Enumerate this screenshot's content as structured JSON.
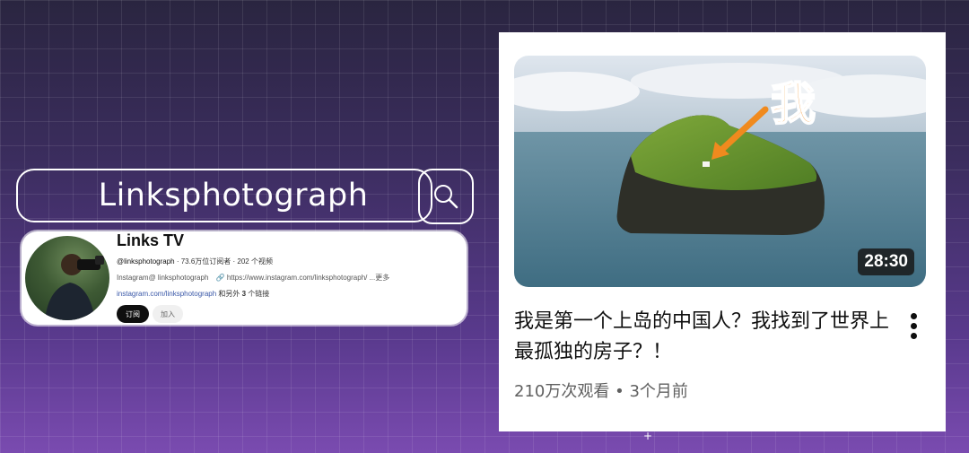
{
  "search": {
    "query": "Linksphotograph"
  },
  "channel": {
    "name": "Links TV",
    "handle": "@linksphotograph",
    "stats": " · 73.6万位订阅者 · 202 个视频",
    "description": "Instagram@ linksphotograph",
    "description_link": "https://www.instagram.com/linksphotograph/ ...更多",
    "primary_link": "instagram.com/linksphotograph",
    "extra_links_prefix": " 和另外 ",
    "extra_links_count": "3",
    "extra_links_suffix": " 个链接",
    "subscribe_label": "订阅",
    "join_label": "加入"
  },
  "video": {
    "thumbnail_overlay_text": "我",
    "duration": "28:30",
    "title": "我是第一个上岛的中国人？我找到了世界上最孤独的房子？！",
    "views": "210万次观看",
    "age": "3个月前"
  },
  "colors": {
    "accent_orange": "#f08a1e",
    "text_primary": "#0f0f0f",
    "text_secondary": "#606060"
  }
}
